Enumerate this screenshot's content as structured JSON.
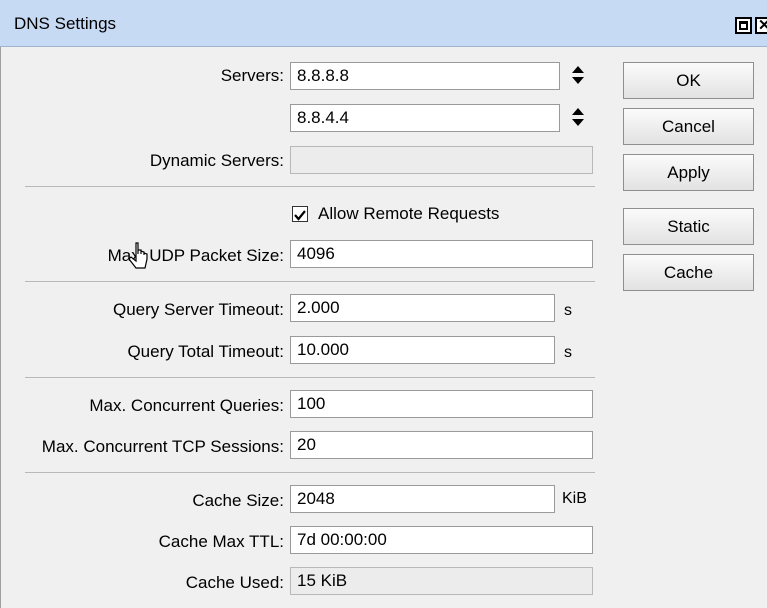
{
  "window": {
    "title": "DNS Settings"
  },
  "fields": {
    "servers_label": "Servers:",
    "server1": "8.8.8.8",
    "server2": "8.8.4.4",
    "dynamic_servers_label": "Dynamic Servers:",
    "dynamic_servers": "",
    "allow_remote_label": "Allow Remote Requests",
    "allow_remote_checked": true,
    "max_udp_label": "Max. UDP Packet Size:",
    "max_udp": "4096",
    "query_server_timeout_label": "Query Server Timeout:",
    "query_server_timeout": "2.000",
    "query_server_timeout_unit": "s",
    "query_total_timeout_label": "Query Total Timeout:",
    "query_total_timeout": "10.000",
    "query_total_timeout_unit": "s",
    "max_concurrent_queries_label": "Max. Concurrent Queries:",
    "max_concurrent_queries": "100",
    "max_concurrent_tcp_label": "Max. Concurrent TCP Sessions:",
    "max_concurrent_tcp": "20",
    "cache_size_label": "Cache Size:",
    "cache_size": "2048",
    "cache_size_unit": "KiB",
    "cache_max_ttl_label": "Cache Max TTL:",
    "cache_max_ttl": "7d 00:00:00",
    "cache_used_label": "Cache Used:",
    "cache_used": "15 KiB"
  },
  "buttons": {
    "ok": "OK",
    "cancel": "Cancel",
    "apply": "Apply",
    "static": "Static",
    "cache": "Cache"
  },
  "icons": {
    "updown": "up-down-arrow-icon",
    "cursor": "mouse-pointer-icon"
  }
}
